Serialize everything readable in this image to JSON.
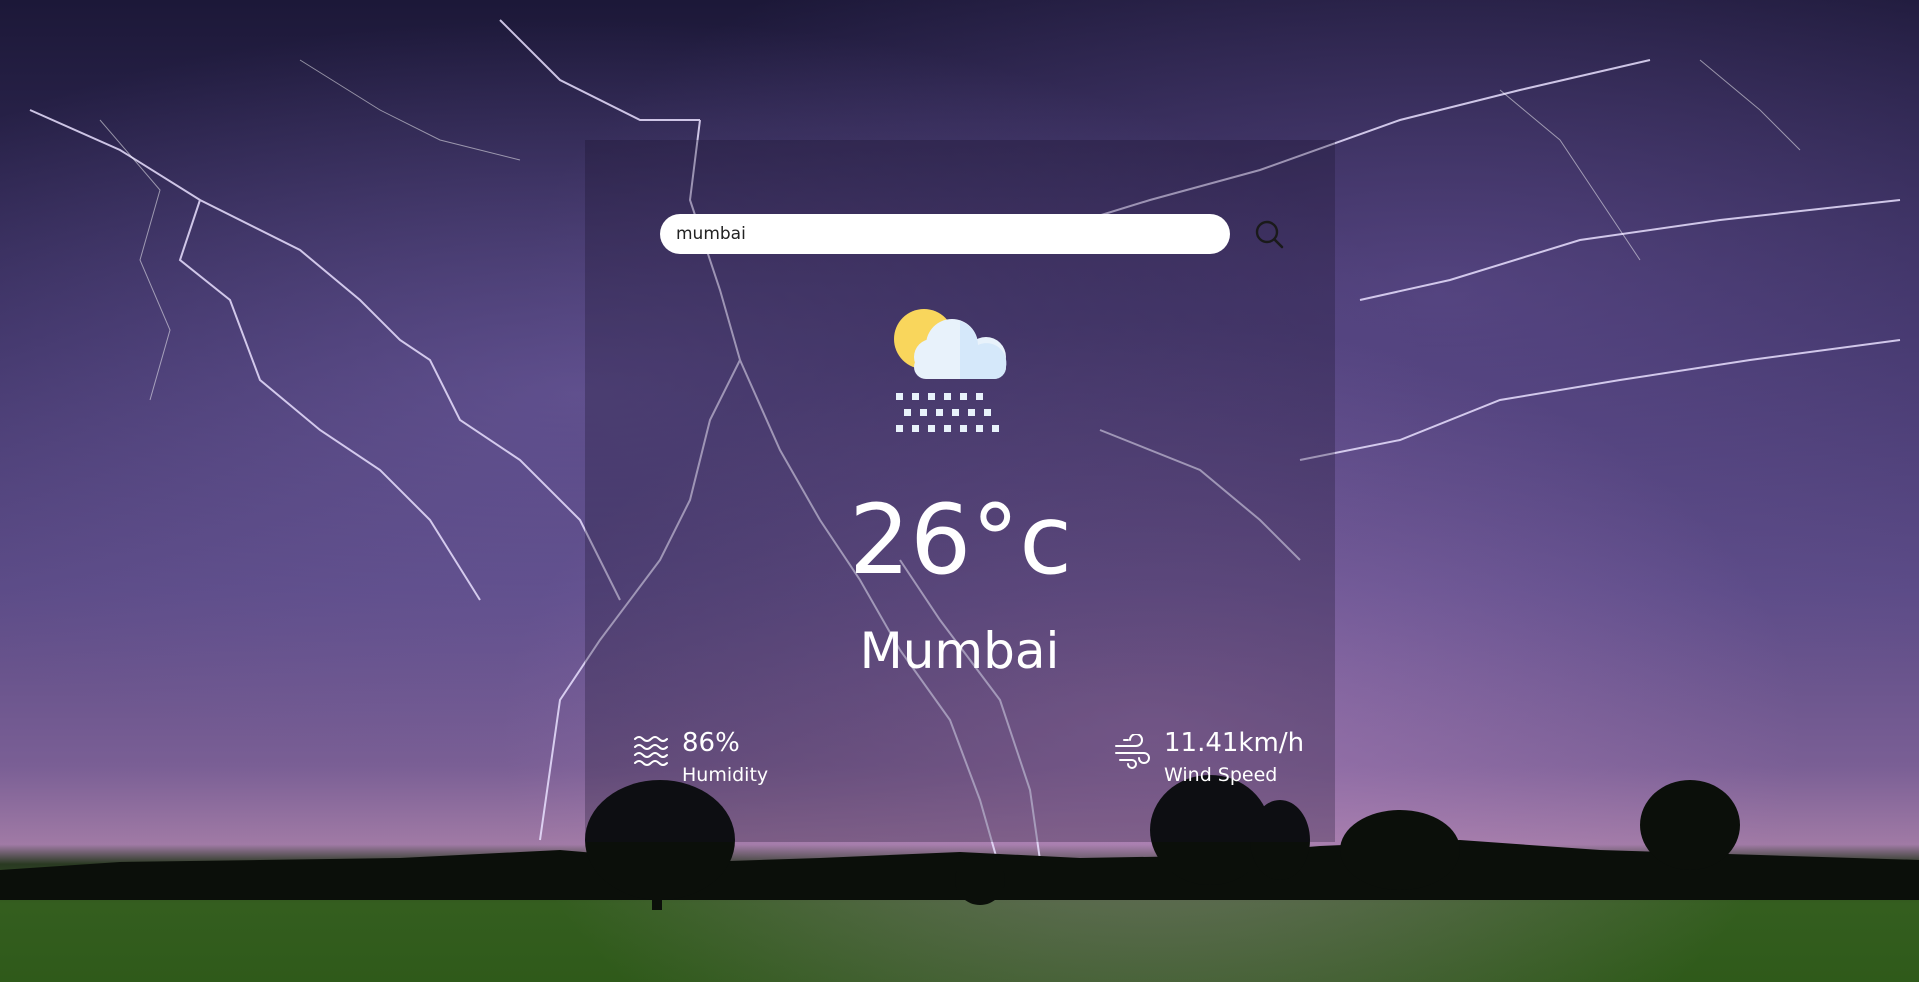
{
  "search": {
    "value": "mumbai",
    "button_icon": "search-icon"
  },
  "weather": {
    "icon": "partly-cloudy-snow-icon",
    "temperature": "26°c",
    "city": "Mumbai"
  },
  "humidity": {
    "icon": "humidity-waves-icon",
    "value": "86%",
    "label": "Humidity"
  },
  "wind": {
    "icon": "wind-icon",
    "value": "11.41km/h",
    "label": "Wind Speed"
  },
  "colors": {
    "sun": "#f9d65c",
    "cloud": "#e8f2fb",
    "text": "#ffffff",
    "search_bg": "#ffffff"
  }
}
